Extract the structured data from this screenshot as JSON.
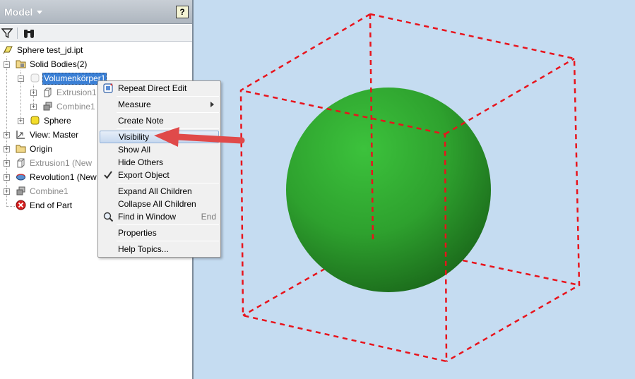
{
  "panel": {
    "title": "Model",
    "help_label": "?"
  },
  "tree": {
    "items": [
      {
        "label": "Sphere test_jd.ipt",
        "icon": "part-file-icon"
      },
      {
        "label": "Solid Bodies(2)",
        "icon": "solid-bodies-folder-icon"
      },
      {
        "label": "Volumenkörper1",
        "icon": "solid-body-icon",
        "selected": true
      },
      {
        "label": "Extrusion1",
        "icon": "extrusion-icon"
      },
      {
        "label": "Combine1",
        "icon": "combine-icon"
      },
      {
        "label": "Sphere",
        "icon": "sphere-body-icon"
      },
      {
        "label": "View: Master",
        "icon": "view-icon"
      },
      {
        "label": "Origin",
        "icon": "folder-icon"
      },
      {
        "label": "Extrusion1 (New",
        "icon": "extrusion-icon"
      },
      {
        "label": "Revolution1 (New",
        "icon": "revolution-icon"
      },
      {
        "label": "Combine1",
        "icon": "combine-icon"
      },
      {
        "label": "End of Part",
        "icon": "end-of-part-icon"
      }
    ]
  },
  "context_menu": {
    "items": [
      {
        "label": "Repeat Direct Edit"
      },
      {
        "label": "Measure"
      },
      {
        "label": "Create Note"
      },
      {
        "label": "Visibility",
        "highlighted": true
      },
      {
        "label": "Show All"
      },
      {
        "label": "Hide Others"
      },
      {
        "label": "Export Object",
        "checked": true
      },
      {
        "label": "Expand All Children"
      },
      {
        "label": "Collapse All Children"
      },
      {
        "label": "Find in Window",
        "shortcut": "End"
      },
      {
        "label": "Properties"
      },
      {
        "label": "Help Topics..."
      }
    ]
  },
  "colors": {
    "viewport_background": "#c5dcf1",
    "sphere": "#2e9e2e",
    "bounding_box": "#e8141c",
    "arrow": "#e04a4a",
    "selection": "#3a7fd5"
  }
}
